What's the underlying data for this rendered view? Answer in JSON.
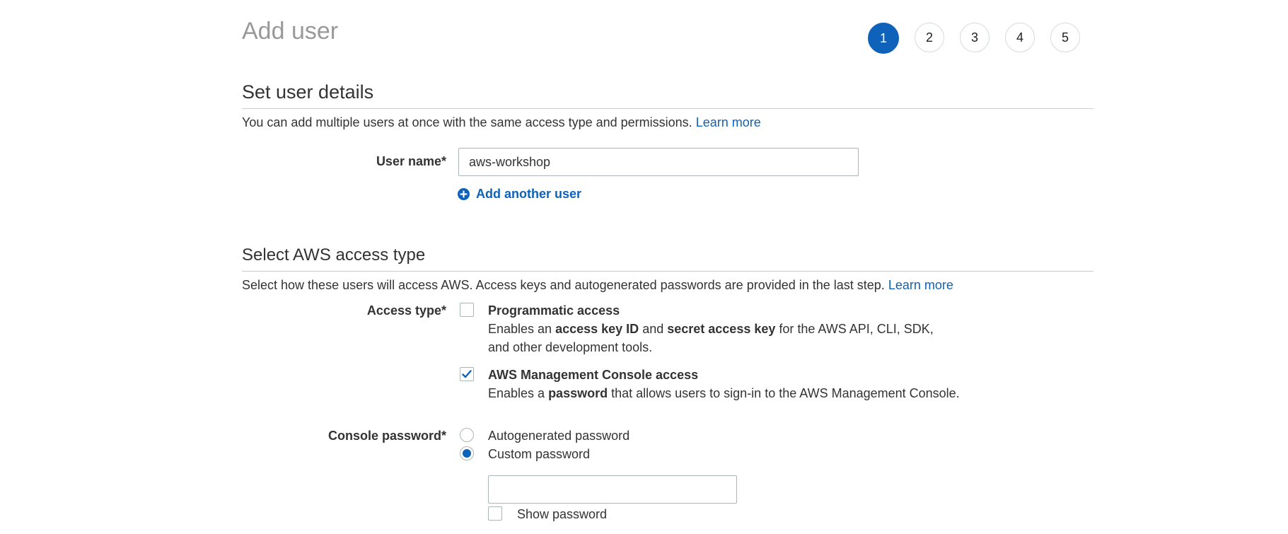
{
  "page": {
    "title": "Add user",
    "steps": [
      "1",
      "2",
      "3",
      "4",
      "5"
    ],
    "active_step": "1"
  },
  "user_details": {
    "heading": "Set user details",
    "description": "You can add multiple users at once with the same access type and permissions.",
    "learn_more": "Learn more",
    "username_label": "User name*",
    "username_value": "aws-workshop",
    "add_another_label": "Add another user"
  },
  "access_type": {
    "heading": "Select AWS access type",
    "description": "Select how these users will access AWS. Access keys and autogenerated passwords are provided in the last step.",
    "learn_more": "Learn more",
    "label": "Access type*",
    "programmatic": {
      "title": "Programmatic access",
      "desc_prefix": "Enables an ",
      "desc_bold1": "access key ID",
      "desc_mid": " and ",
      "desc_bold2": "secret access key",
      "desc_suffix": " for the AWS API, CLI, SDK, and other development tools.",
      "checked": false
    },
    "console": {
      "title": "AWS Management Console access",
      "desc_prefix": "Enables a ",
      "desc_bold": "password",
      "desc_suffix": " that allows users to sign-in to the AWS Management Console.",
      "checked": true
    }
  },
  "console_password": {
    "label": "Console password*",
    "options": [
      "Autogenerated password",
      "Custom password"
    ],
    "selected": "Custom password",
    "password_value": "",
    "show_password_label": "Show password",
    "show_password_checked": false
  },
  "colors": {
    "accent": "#0f62b9",
    "title_gray": "#999999",
    "text": "#333333",
    "border": "#aab7b8"
  }
}
